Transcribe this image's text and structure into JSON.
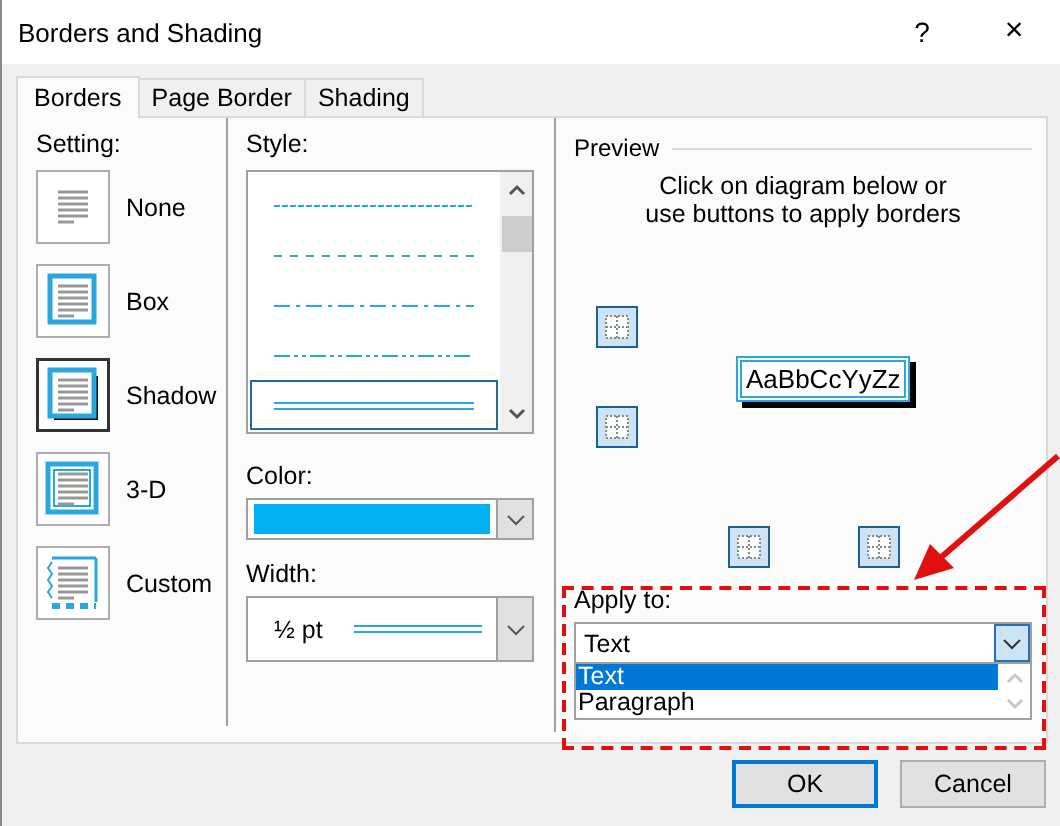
{
  "window": {
    "title": "Borders and Shading",
    "help": "?",
    "close": "×"
  },
  "tabs": [
    {
      "label": "Borders",
      "selected": true
    },
    {
      "label": "Page Border",
      "selected": false
    },
    {
      "label": "Shading",
      "selected": false
    }
  ],
  "setting": {
    "label": "Setting:",
    "options": [
      {
        "label": "None",
        "kind": "none",
        "selected": false
      },
      {
        "label": "Box",
        "kind": "box",
        "selected": false
      },
      {
        "label": "Shadow",
        "kind": "shadow",
        "selected": true
      },
      {
        "label": "3-D",
        "kind": "threed",
        "selected": false
      },
      {
        "label": "Custom",
        "kind": "custom",
        "selected": false
      }
    ]
  },
  "style": {
    "label": "Style:",
    "items": [
      {
        "kind": "dotted",
        "selected": false
      },
      {
        "kind": "dashed",
        "selected": false
      },
      {
        "kind": "dash-dot",
        "selected": false
      },
      {
        "kind": "dash-dot-dot",
        "selected": false
      },
      {
        "kind": "double",
        "selected": true
      }
    ]
  },
  "color": {
    "label": "Color:",
    "color": "#00b0f0"
  },
  "width": {
    "label": "Width:",
    "value": "½ pt"
  },
  "preview": {
    "label": "Preview",
    "hint": "Click on diagram below or\nuse buttons to apply borders",
    "sample": "AaBbCcYyZz"
  },
  "apply_to": {
    "label": "Apply to:",
    "value": "Text",
    "options": [
      {
        "label": "Text",
        "selected": true
      },
      {
        "label": "Paragraph",
        "selected": false
      }
    ]
  },
  "buttons": [
    {
      "label": "OK",
      "default": true
    },
    {
      "label": "Cancel",
      "default": false
    }
  ]
}
